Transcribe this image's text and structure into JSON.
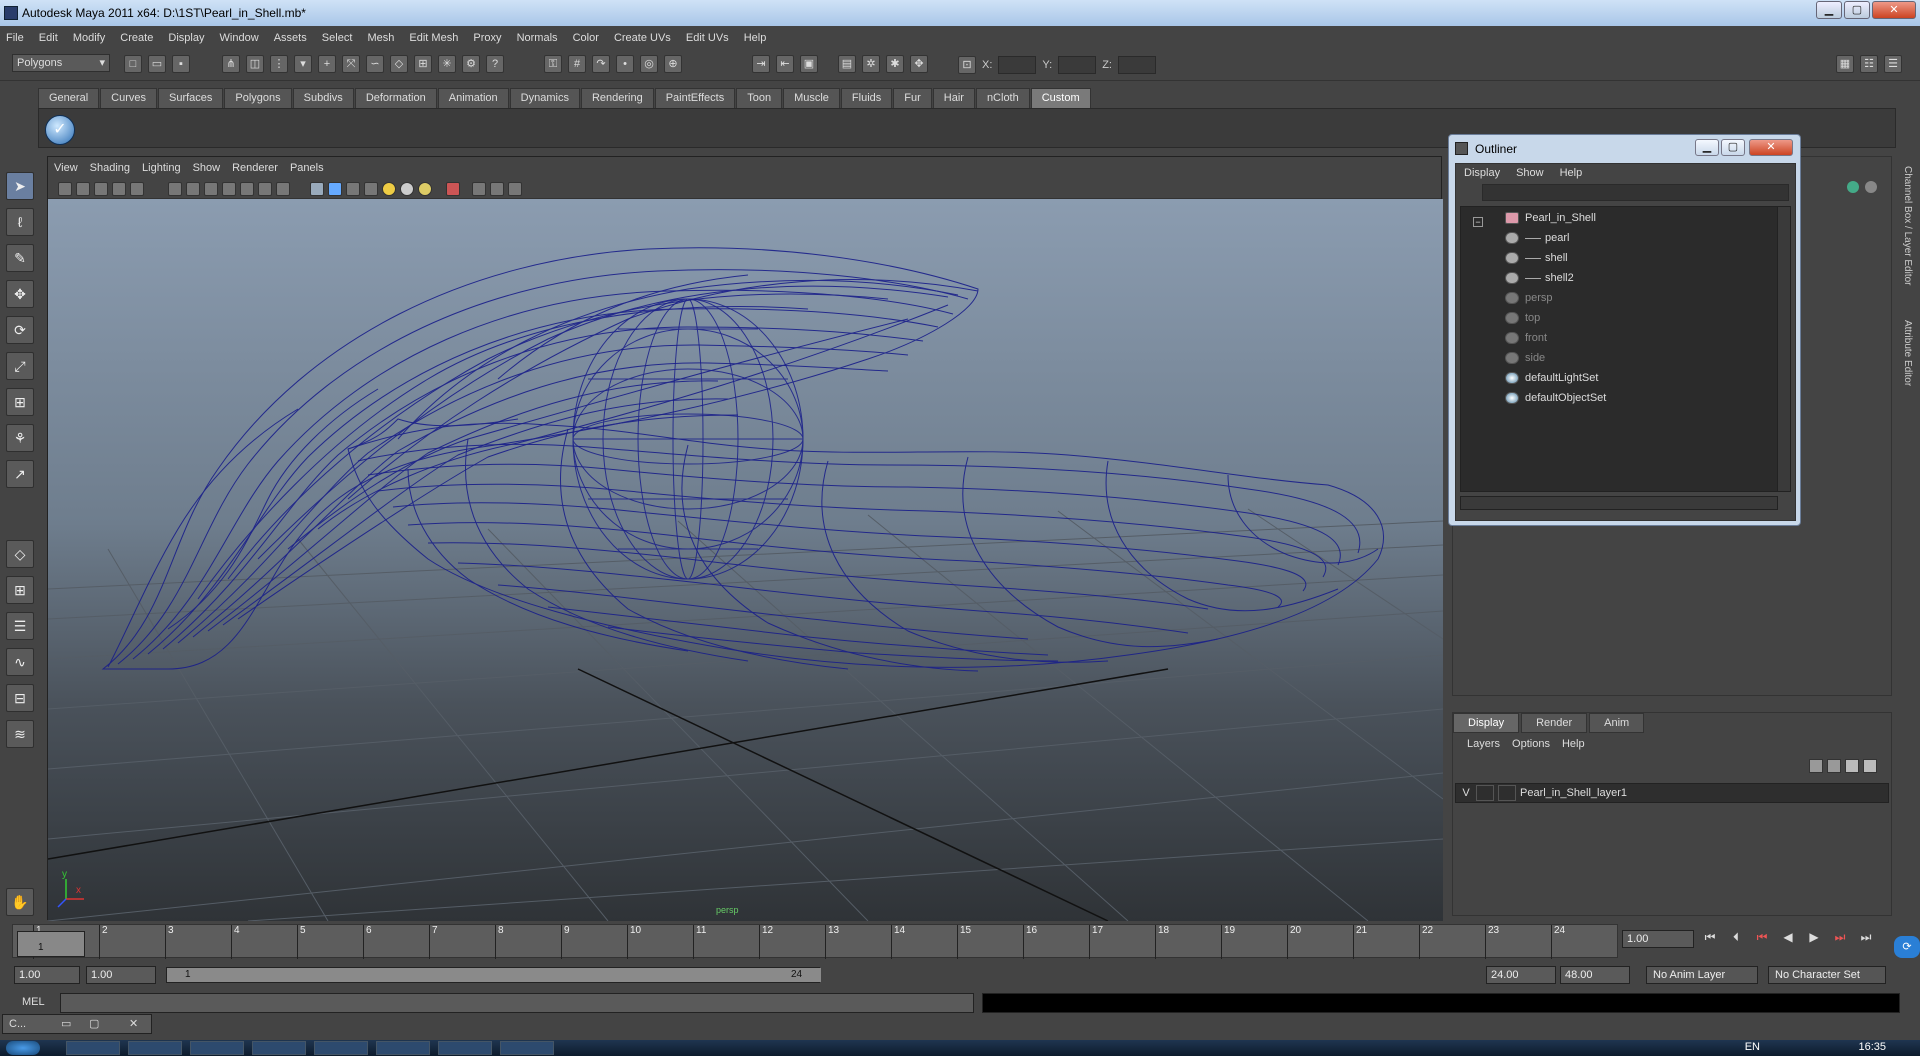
{
  "window": {
    "title": "Autodesk Maya 2011 x64: D:\\1ST\\Pearl_in_Shell.mb*"
  },
  "menubar": [
    "File",
    "Edit",
    "Modify",
    "Create",
    "Display",
    "Window",
    "Assets",
    "Select",
    "Mesh",
    "Edit Mesh",
    "Proxy",
    "Normals",
    "Color",
    "Create UVs",
    "Edit UVs",
    "Help"
  ],
  "status": {
    "mode": "Polygons",
    "x_label": "X:",
    "y_label": "Y:",
    "z_label": "Z:"
  },
  "shelf_tabs": [
    "General",
    "Curves",
    "Surfaces",
    "Polygons",
    "Subdivs",
    "Deformation",
    "Animation",
    "Dynamics",
    "Rendering",
    "PaintEffects",
    "Toon",
    "Muscle",
    "Fluids",
    "Fur",
    "Hair",
    "nCloth",
    "Custom"
  ],
  "shelf_active": "Custom",
  "viewport": {
    "menu": [
      "View",
      "Shading",
      "Lighting",
      "Show",
      "Renderer",
      "Panels"
    ],
    "camera_label": "persp",
    "axis_y": "y",
    "axis_x": "x",
    "wire_color": "#1a1f8a"
  },
  "outliner": {
    "title": "Outliner",
    "menu": [
      "Display",
      "Show",
      "Help"
    ],
    "items": [
      {
        "label": "Pearl_in_Shell",
        "dim": false
      },
      {
        "label": "pearl",
        "dim": false
      },
      {
        "label": "shell",
        "dim": false
      },
      {
        "label": "shell2",
        "dim": false
      },
      {
        "label": "persp",
        "dim": true
      },
      {
        "label": "top",
        "dim": true
      },
      {
        "label": "front",
        "dim": true
      },
      {
        "label": "side",
        "dim": true
      },
      {
        "label": "defaultLightSet",
        "dim": false
      },
      {
        "label": "defaultObjectSet",
        "dim": false
      }
    ]
  },
  "side_tabs": [
    "Channel Box / Layer Editor",
    "Attribute Editor"
  ],
  "layers": {
    "tabs": [
      "Display",
      "Render",
      "Anim"
    ],
    "menu": [
      "Layers",
      "Options",
      "Help"
    ],
    "row": {
      "visible": "V",
      "name": "Pearl_in_Shell_layer1"
    }
  },
  "timeline": {
    "ticks": [
      "1",
      "2",
      "3",
      "4",
      "5",
      "6",
      "7",
      "8",
      "9",
      "10",
      "11",
      "12",
      "13",
      "14",
      "15",
      "16",
      "17",
      "18",
      "19",
      "20",
      "21",
      "22",
      "23",
      "24"
    ],
    "current_frame_label": "1",
    "current": "1.00"
  },
  "range": {
    "start": "1.00",
    "playback_start": "1.00",
    "slider_start": "1",
    "slider_end": "24",
    "playback_end": "24.00",
    "end": "48.00",
    "anim_layer": "No Anim Layer",
    "char_set": "No Character Set"
  },
  "cmd": {
    "label": "MEL"
  },
  "minwin": {
    "label": "C..."
  },
  "taskbar": {
    "lang": "EN",
    "clock": "16:35"
  }
}
